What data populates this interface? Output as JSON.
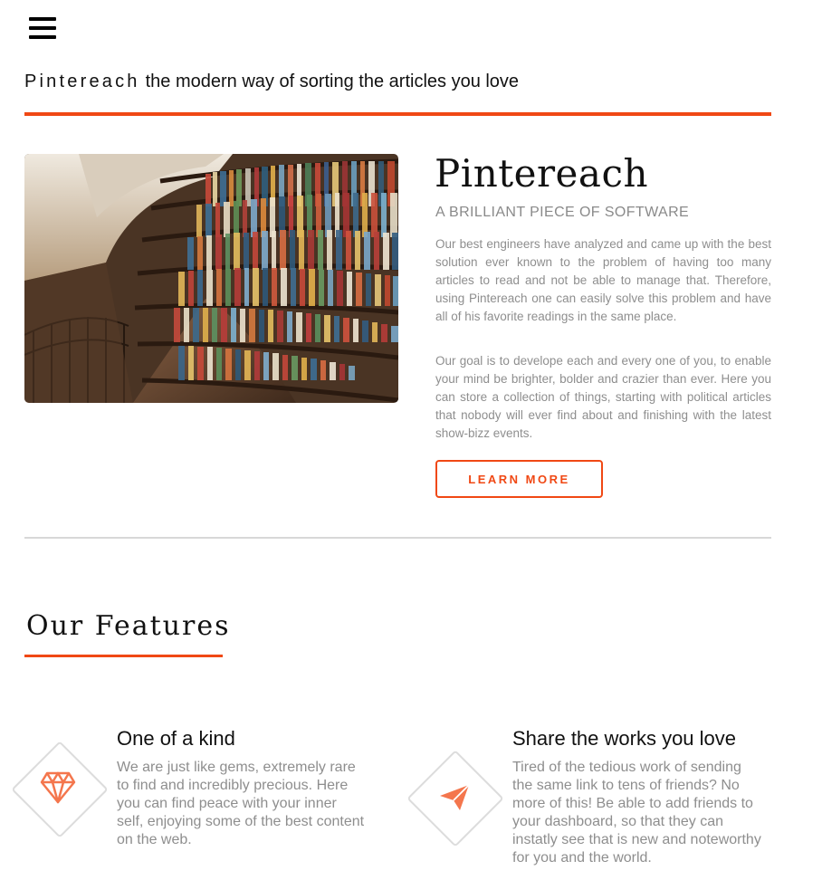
{
  "header": {
    "menu_icon": "hamburger-menu-icon",
    "brand": "Pintereach",
    "tagline": "the modern way of sorting the articles you love"
  },
  "hero": {
    "image_alt": "library bookshelves photo",
    "title": "Pintereach",
    "subtitle": "A BRILLIANT PIECE OF SOFTWARE",
    "paragraph1": "Our best engineers have analyzed and came up with the best solution ever known to the problem of having too many articles to read and not be able to manage that. Therefore, using Pintereach one can easily solve this problem and have all of his favorite readings in the same place.",
    "paragraph2": "Our goal is to develope each and every one of you, to enable your mind be brighter, bolder and crazier than ever. Here you can store a collection of things, starting with political articles that nobody will ever find about and finishing with the latest show-bizz events.",
    "button_label": "LEARN MORE"
  },
  "features": {
    "title": "Our Features",
    "items": [
      {
        "icon": "gem-icon",
        "title": "One of a kind",
        "text": "We are just like gems, extremely rare to find and incredibly precious. Here you can find peace with your inner self, enjoying some of the best content on the web."
      },
      {
        "icon": "paper-plane-icon",
        "title": "Share the works you love",
        "text": "Tired of the tedious work of sending the same link to tens of friends? No more of this! Be able to add friends to your dashboard, so that they can instatly see that is new and noteworthy for you and the world."
      }
    ]
  },
  "colors": {
    "accent": "#f04814",
    "muted_text": "#8e8e8e",
    "divider": "#d8d8d8"
  }
}
